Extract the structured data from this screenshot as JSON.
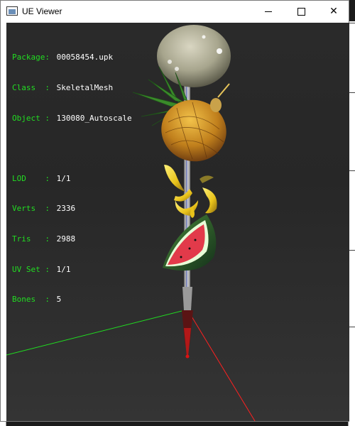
{
  "window": {
    "title": "UE Viewer",
    "controls": {
      "minimize": "",
      "maximize": "",
      "close": "✕"
    }
  },
  "info_panel": {
    "package": {
      "label": "Package:",
      "value": "00058454.upk"
    },
    "class": {
      "label": "Class  :",
      "value": "SkeletalMesh"
    },
    "object": {
      "label": "Object :",
      "value": "130080_Autoscale"
    },
    "lod": {
      "label": "LOD    :",
      "value": "1/1"
    },
    "verts": {
      "label": "Verts  :",
      "value": "2336"
    },
    "tris": {
      "label": "Tris   :",
      "value": "2988"
    },
    "uvset": {
      "label": "UV Set :",
      "value": "1/1"
    },
    "bones": {
      "label": "Bones  :",
      "value": "5"
    }
  },
  "colors": {
    "label_text": "#22dd22",
    "value_text": "#ffffff",
    "axis_x": "#ff2020",
    "axis_y": "#20dd20",
    "axis_z": "#3040ff"
  }
}
